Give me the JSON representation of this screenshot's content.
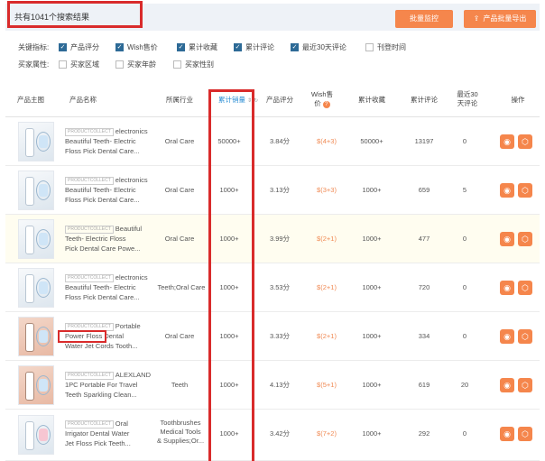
{
  "header": {
    "result_count": "共有1041个搜索结果",
    "btn_monitor": "批量监控",
    "btn_export": "产品批量导出"
  },
  "filters": {
    "metric_label": "关键指标:",
    "metrics": [
      {
        "label": "产品评分",
        "checked": true
      },
      {
        "label": "Wish售价",
        "checked": true
      },
      {
        "label": "累计收藏",
        "checked": true
      },
      {
        "label": "累计评论",
        "checked": true
      },
      {
        "label": "最近30天评论",
        "checked": true
      },
      {
        "label": "刊登时间",
        "checked": false
      }
    ],
    "buyer_label": "买家属性:",
    "buyers": [
      {
        "label": "买家区域",
        "checked": false
      },
      {
        "label": "买家年龄",
        "checked": false
      },
      {
        "label": "买家性别",
        "checked": false
      }
    ]
  },
  "columns": {
    "image": "产品主图",
    "name": "产品名称",
    "industry": "所属行业",
    "sales": "累计销量",
    "rating": "产品评分",
    "price_line1": "Wish售",
    "price_line2": "价",
    "favorites": "累计收藏",
    "reviews": "累计评论",
    "recent_line1": "最近30",
    "recent_line2": "天评论",
    "actions": "操作"
  },
  "rows": [
    {
      "tag": "PRODUCTCOLLECT",
      "name_l1": "electronics",
      "name_l2": "Beautiful Teeth- Electric",
      "name_l3": "Floss Pick Dental Care...",
      "industry_l1": "Oral Care",
      "industry_l2": "",
      "industry_l3": "",
      "sales": "50000+",
      "rating": "3.84分",
      "price": "$(4+3)",
      "favorites": "50000+",
      "reviews": "13197",
      "recent": "0"
    },
    {
      "tag": "PRODUCTCOLLECT",
      "name_l1": "electronics",
      "name_l2": "Beautiful Teeth- Electric",
      "name_l3": "Floss Pick Dental Care...",
      "industry_l1": "Oral Care",
      "industry_l2": "",
      "industry_l3": "",
      "sales": "1000+",
      "rating": "3.13分",
      "price": "$(3+3)",
      "favorites": "1000+",
      "reviews": "659",
      "recent": "5"
    },
    {
      "tag": "PRODUCTCOLLECT",
      "name_l1": "Beautiful",
      "name_l2": "Teeth- Electric Floss",
      "name_l3": "Pick Dental Care Powe...",
      "industry_l1": "Oral Care",
      "industry_l2": "",
      "industry_l3": "",
      "sales": "1000+",
      "rating": "3.99分",
      "price": "$(2+1)",
      "favorites": "1000+",
      "reviews": "477",
      "recent": "0"
    },
    {
      "tag": "PRODUCTCOLLECT",
      "name_l1": "electronics",
      "name_l2": "Beautiful Teeth- Electric",
      "name_l3": "Floss Pick Dental Care...",
      "industry_l1": "Teeth;Oral Care",
      "industry_l2": "",
      "industry_l3": "",
      "sales": "1000+",
      "rating": "3.53分",
      "price": "$(2+1)",
      "favorites": "1000+",
      "reviews": "720",
      "recent": "0"
    },
    {
      "tag": "PRODUCTCOLLECT",
      "name_l1": "Portable",
      "name_l2": "Power Floss Dental",
      "name_l3": "Water Jet Cords Tooth...",
      "industry_l1": "Oral Care",
      "industry_l2": "",
      "industry_l3": "",
      "sales": "1000+",
      "rating": "3.33分",
      "price": "$(2+1)",
      "favorites": "1000+",
      "reviews": "334",
      "recent": "0"
    },
    {
      "tag": "PRODUCTCOLLECT",
      "name_l1": "ALEXLAND",
      "name_l2": "1PC Portable For Travel",
      "name_l3": "Teeth Sparkling Clean...",
      "industry_l1": "Teeth",
      "industry_l2": "",
      "industry_l3": "",
      "sales": "1000+",
      "rating": "4.13分",
      "price": "$(5+1)",
      "favorites": "1000+",
      "reviews": "619",
      "recent": "20"
    },
    {
      "tag": "PRODUCTCOLLECT",
      "name_l1": "Oral",
      "name_l2": "Irrigator Dental Water",
      "name_l3": "Jet Floss Pick Teeth...",
      "industry_l1": "Toothbrushes",
      "industry_l2": "Medical Tools",
      "industry_l3": "& Supplies;Or...",
      "sales": "1000+",
      "rating": "3.42分",
      "price": "$(7+2)",
      "favorites": "1000+",
      "reviews": "292",
      "recent": "0"
    }
  ],
  "colors": {
    "accent": "#f5864c",
    "highlight": "#d92b2b",
    "check": "#2d6a96",
    "link": "#2d8fd5"
  }
}
